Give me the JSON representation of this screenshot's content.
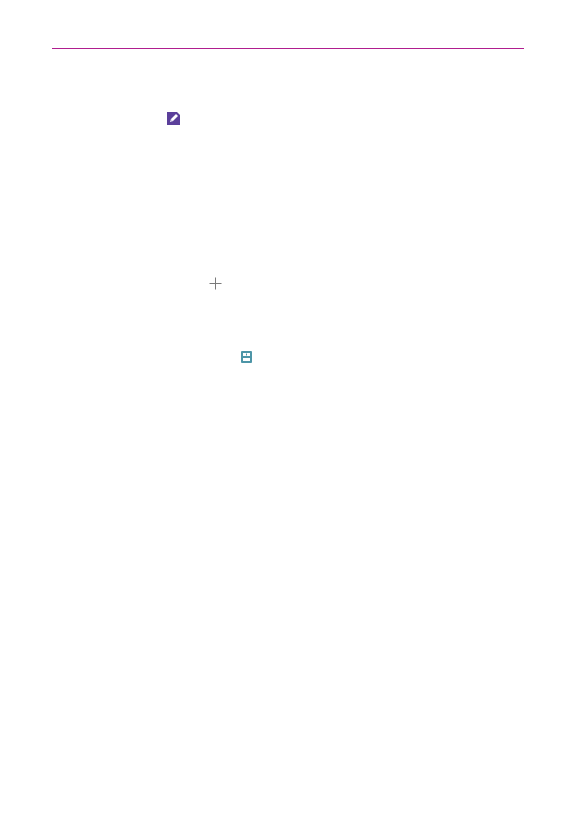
{
  "page": {
    "accent_color": "#b01e8f"
  },
  "icons": [
    {
      "name": "memo-edit-icon",
      "color": "#5b3f9b"
    },
    {
      "name": "plus-icon",
      "color": "#7a7a7a"
    },
    {
      "name": "archive-icon",
      "color": "#4d95a7"
    }
  ]
}
